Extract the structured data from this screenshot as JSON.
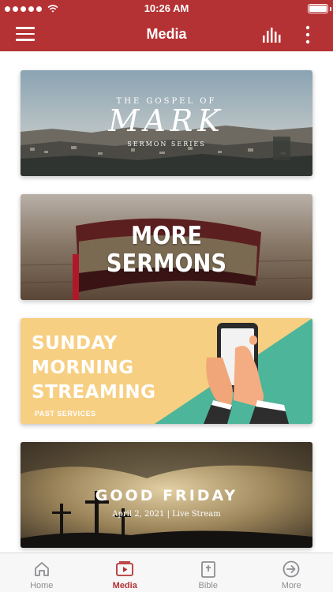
{
  "status_bar": {
    "time": "10:26 AM"
  },
  "nav": {
    "title": "Media"
  },
  "cards": [
    {
      "top_text": "THE GOSPEL OF",
      "title": "MARK",
      "subtitle": "SERMON SERIES"
    },
    {
      "line1": "MORE",
      "line2": "SERMONS"
    },
    {
      "line1": "SUNDAY",
      "line2": "MORNING",
      "line3": "STREAMING",
      "caption": "PAST SERVICES"
    },
    {
      "title": "GOOD FRIDAY",
      "subtitle": "April 2, 2021 | Live Stream"
    }
  ],
  "tabs": [
    {
      "label": "Home",
      "icon": "home-icon"
    },
    {
      "label": "Media",
      "icon": "media-icon",
      "active": true
    },
    {
      "label": "Bible",
      "icon": "bible-icon"
    },
    {
      "label": "More",
      "icon": "more-arrow-icon"
    }
  ],
  "colors": {
    "brand": "#b53234",
    "tab_inactive": "#8e8e93"
  }
}
